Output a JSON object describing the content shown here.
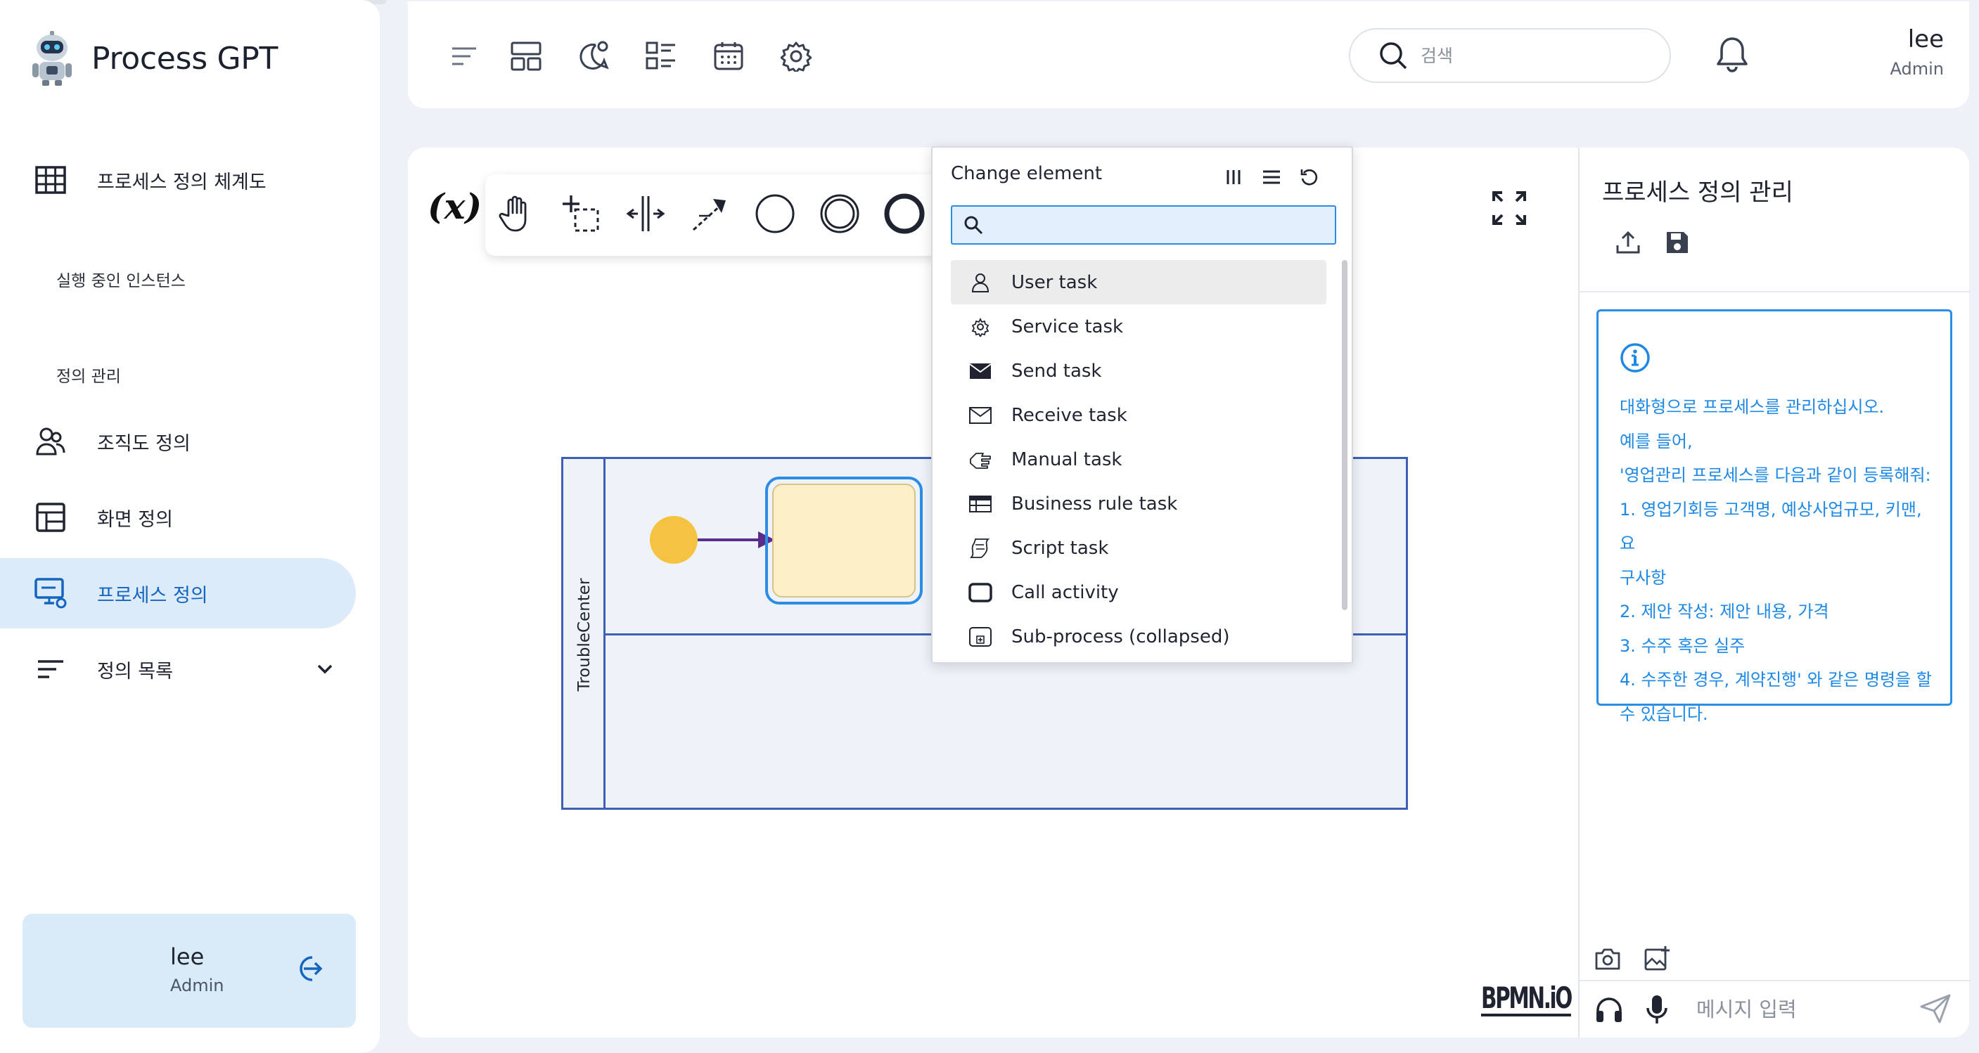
{
  "app": {
    "name": "Process GPT"
  },
  "sidebar": {
    "items": [
      {
        "label": "프로세스 정의 체계도",
        "icon": "grid-icon"
      },
      {
        "label": "조직도 정의",
        "icon": "people-icon"
      },
      {
        "label": "화면 정의",
        "icon": "layout-icon"
      },
      {
        "label": "프로세스 정의",
        "icon": "process-monitor-icon",
        "active": true
      },
      {
        "label": "정의 목록",
        "icon": "list-icon"
      }
    ],
    "captions": {
      "running": "실행 중인 인스턴스",
      "definitions": "정의 관리"
    },
    "user": {
      "name": "lee",
      "role": "Admin"
    }
  },
  "topbar": {
    "search_placeholder": "검색",
    "user": {
      "name": "lee",
      "role": "Admin"
    }
  },
  "canvas": {
    "pool_label": "TroubleCenter",
    "palette_variable": "(x)",
    "brand": "BPMN.iO"
  },
  "popup": {
    "title": "Change element",
    "search_value": "",
    "items": [
      {
        "label": "User task",
        "icon": "user-task-icon",
        "highlighted": true
      },
      {
        "label": "Service task",
        "icon": "service-task-icon"
      },
      {
        "label": "Send task",
        "icon": "send-task-icon"
      },
      {
        "label": "Receive task",
        "icon": "receive-task-icon"
      },
      {
        "label": "Manual task",
        "icon": "manual-task-icon"
      },
      {
        "label": "Business rule task",
        "icon": "business-rule-task-icon"
      },
      {
        "label": "Script task",
        "icon": "script-task-icon"
      },
      {
        "label": "Call activity",
        "icon": "call-activity-icon"
      },
      {
        "label": "Sub-process (collapsed)",
        "icon": "sub-process-icon"
      }
    ]
  },
  "right_panel": {
    "title": "프로세스 정의 관리",
    "info_lines": [
      "대화형으로 프로세스를 관리하십시오.",
      "예를 들어,",
      "'영업관리 프로세스를 다음과 같이 등록해줘:",
      "1. 영업기회등 고객명, 예상사업규모, 키맨, 요",
      "구사항",
      "2. 제안 작성: 제안 내용, 가격",
      "3. 수주 혹은 실주",
      "4. 수주한 경우, 계약진행' 와 같은 명령을 할",
      "수 있습니다."
    ],
    "message_placeholder": "메시지 입력"
  },
  "colors": {
    "accent": "#1e88e5",
    "active_bg": "#dcebfa",
    "start_event": "#f5c242",
    "task_fill": "#fdf0c8",
    "pool_border": "#3f5fb5"
  }
}
